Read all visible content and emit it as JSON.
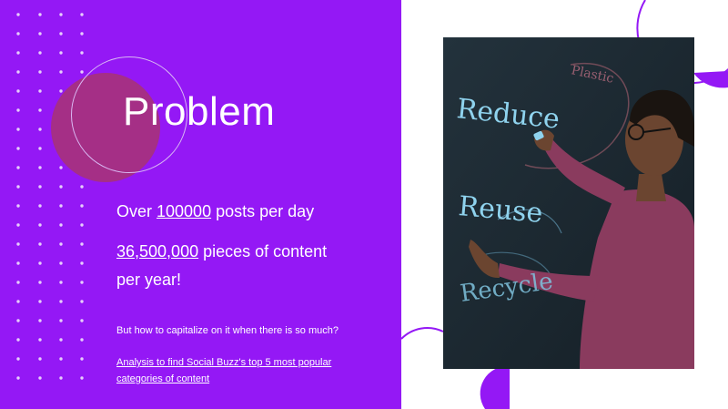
{
  "slide": {
    "title": "Problem",
    "stat1": {
      "prefix": "Over ",
      "number": "100000",
      "suffix": " posts per day"
    },
    "stat2": {
      "number": "36,500,000",
      "line1_suffix": " pieces of content",
      "line2": "per year!"
    },
    "question": "But how to capitalize on it when there is so much?",
    "analysis_link": {
      "line1": "Analysis to find Social Buzz's top 5 most popular",
      "line2": "categories of content"
    }
  },
  "photo": {
    "board_words": [
      "Reduce",
      "Reuse",
      "Recycle",
      "Plastic"
    ]
  },
  "colors": {
    "accent_purple": "#9418f5",
    "circle_magenta": "#a52f86",
    "chalk_blue": "#8fd3ee"
  }
}
